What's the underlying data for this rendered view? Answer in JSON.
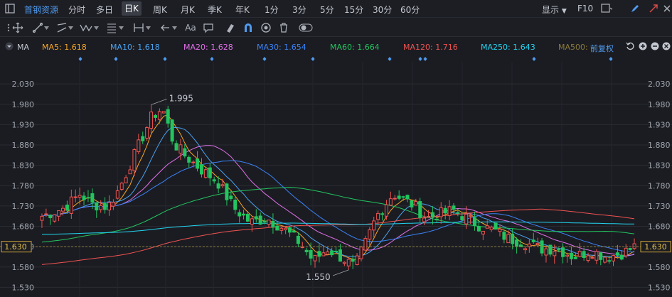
{
  "header": {
    "stock_name": "首钢资源",
    "periods": [
      "分时",
      "多日",
      "日K",
      "周K",
      "月K",
      "季K",
      "年K",
      "1分",
      "3分",
      "5分",
      "15分",
      "30分",
      "60分"
    ],
    "active_period": "日K",
    "display_label": "显示",
    "f10_label": "F10"
  },
  "legend": {
    "indicator": "MA",
    "items": [
      {
        "label": "MA5: 1.618",
        "color": "#f5a623"
      },
      {
        "label": "MA10: 1.618",
        "color": "#4aa3f0"
      },
      {
        "label": "MA20: 1.628",
        "color": "#e070e8"
      },
      {
        "label": "MA30: 1.654",
        "color": "#3b82f6"
      },
      {
        "label": "MA60: 1.664",
        "color": "#22c55e"
      },
      {
        "label": "MA120: 1.716",
        "color": "#ef5350"
      },
      {
        "label": "MA250: 1.643",
        "color": "#22d3ee"
      },
      {
        "label": "MA500: --",
        "color": "#8a7a3a"
      }
    ],
    "adjust_label": "前复权"
  },
  "chart_data": {
    "type": "candlestick",
    "ylim": [
      1.515,
      2.06
    ],
    "y_ticks": [
      "2.030",
      "1.980",
      "1.930",
      "1.880",
      "1.830",
      "1.780",
      "1.730",
      "1.680",
      "1.630",
      "1.580",
      "1.530"
    ],
    "current_price": "1.630",
    "annotations": {
      "high": "1.995",
      "low": "1.550"
    },
    "colors": {
      "up": "#ef5350",
      "down": "#22c55e"
    }
  }
}
